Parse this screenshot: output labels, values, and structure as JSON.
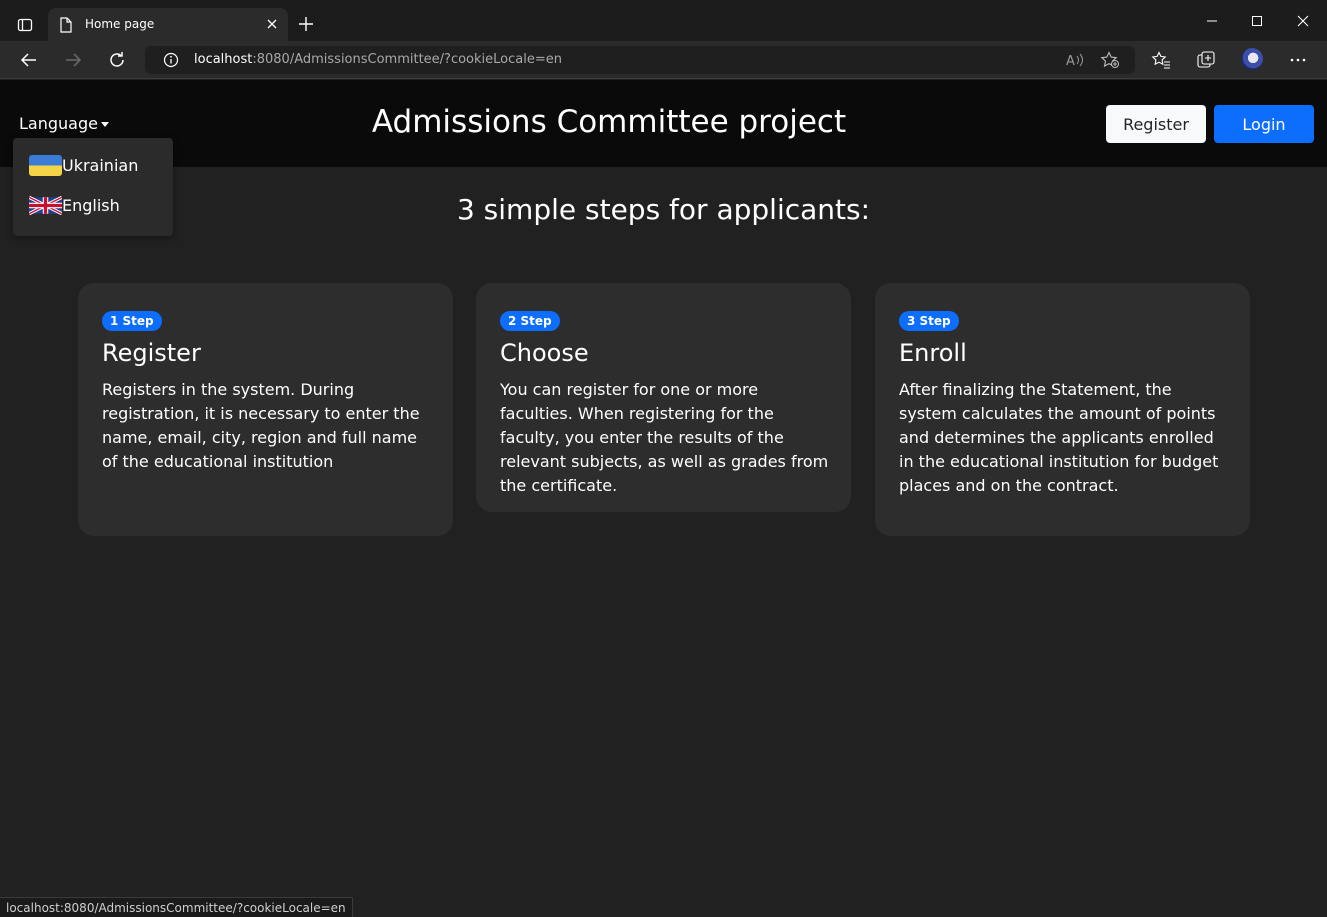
{
  "browser": {
    "tab_title": "Home page",
    "url_host": "localhost",
    "url_rest": ":8080/AdmissionsCommittee/?cookieLocale=en",
    "status_url": "localhost:8080/AdmissionsCommittee/?cookieLocale=en"
  },
  "navbar": {
    "language_label": "Language",
    "brand": "Admissions Committee project",
    "register_label": "Register",
    "login_label": "Login",
    "languages": [
      {
        "label": "Ukrainian",
        "flag": "ukraine-flag-icon"
      },
      {
        "label": "English",
        "flag": "uk-flag-icon"
      }
    ]
  },
  "main": {
    "heading": "3 simple steps for applicants:",
    "steps": [
      {
        "badge": "1 Step",
        "title": "Register",
        "text": "Registers in the system. During registration, it is necessary to enter the name, email, city, region and full name of the educational institution"
      },
      {
        "badge": "2 Step",
        "title": "Choose",
        "text": "You can register for one or more faculties. When registering for the faculty, you enter the results of the relevant subjects, as well as grades from the certificate."
      },
      {
        "badge": "3 Step",
        "title": "Enroll",
        "text": "After finalizing the Statement, the system calculates the amount of points and determines the applicants enrolled in the educational institution for budget places and on the contract."
      }
    ]
  },
  "colors": {
    "primary": "#0d6efd",
    "page_bg": "#212121",
    "navbar_bg": "#0a0a0a",
    "card_bg": "#2d2d2d"
  }
}
